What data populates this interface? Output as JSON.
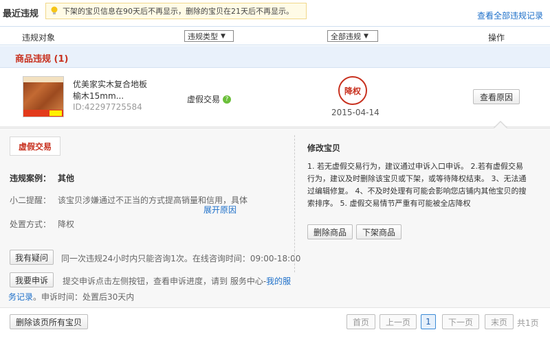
{
  "header": {
    "title": "最近违规",
    "notice": "下架的宝贝信息在90天后不再显示，删除的宝贝在21天后不再显示。",
    "all_records_link": "查看全部违规记录"
  },
  "table_head": {
    "target": "违规对象",
    "type_select": "违规类型",
    "status_select": "全部违规",
    "ops": "操作"
  },
  "group": {
    "label": "商品违规 (1)"
  },
  "item": {
    "name_line1": "优美家实木复合地板",
    "name_line2": "榆木15mm...",
    "product_id": "ID:42297725584",
    "violation_type": "虚假交易",
    "penalty": "降权",
    "date": "2015-04-14",
    "reason_button": "查看原因"
  },
  "detail": {
    "tab": "虚假交易",
    "case_label": "违规案例：",
    "case_value": "其他",
    "tip_label": "小二提醒：",
    "tip_value": "该宝贝涉嫌通过不正当的方式提高销量和信用，具体",
    "expand_link": "展开原因",
    "action_label": "处置方式：",
    "action_value": "降权",
    "ask_button": "我有疑问",
    "ask_text": "同一次违规24小时内只能咨询1次。在线咨询时间：09:00-18:00",
    "appeal_button": "我要申诉",
    "appeal_text": "提交申诉点击左侧按钮，查看申诉进度，请到 服务中心-",
    "appeal_link": "我的服",
    "appeal_link2": "务记录",
    "appeal_text2": "。申诉时间：处置后30天内",
    "fix_title": "修改宝贝",
    "fix_text": "1. 若无虚假交易行为，建议通过申诉入口申诉。 2.若有虚假交易行为，建议及时删除该宝贝或下架，或等待降权结束。 3、无法通过编辑修复。 4、不及时处理有可能会影响您店铺内其他宝贝的搜索排序。 5. 虚假交易情节严重有可能被全店降权",
    "delete_button": "删除商品",
    "delist_button": "下架商品"
  },
  "footer": {
    "delete_all_button": "删除该页所有宝贝",
    "first": "首页",
    "prev": "上一页",
    "current_page": "1",
    "next": "下一页",
    "last": "末页",
    "total": "共1页"
  }
}
